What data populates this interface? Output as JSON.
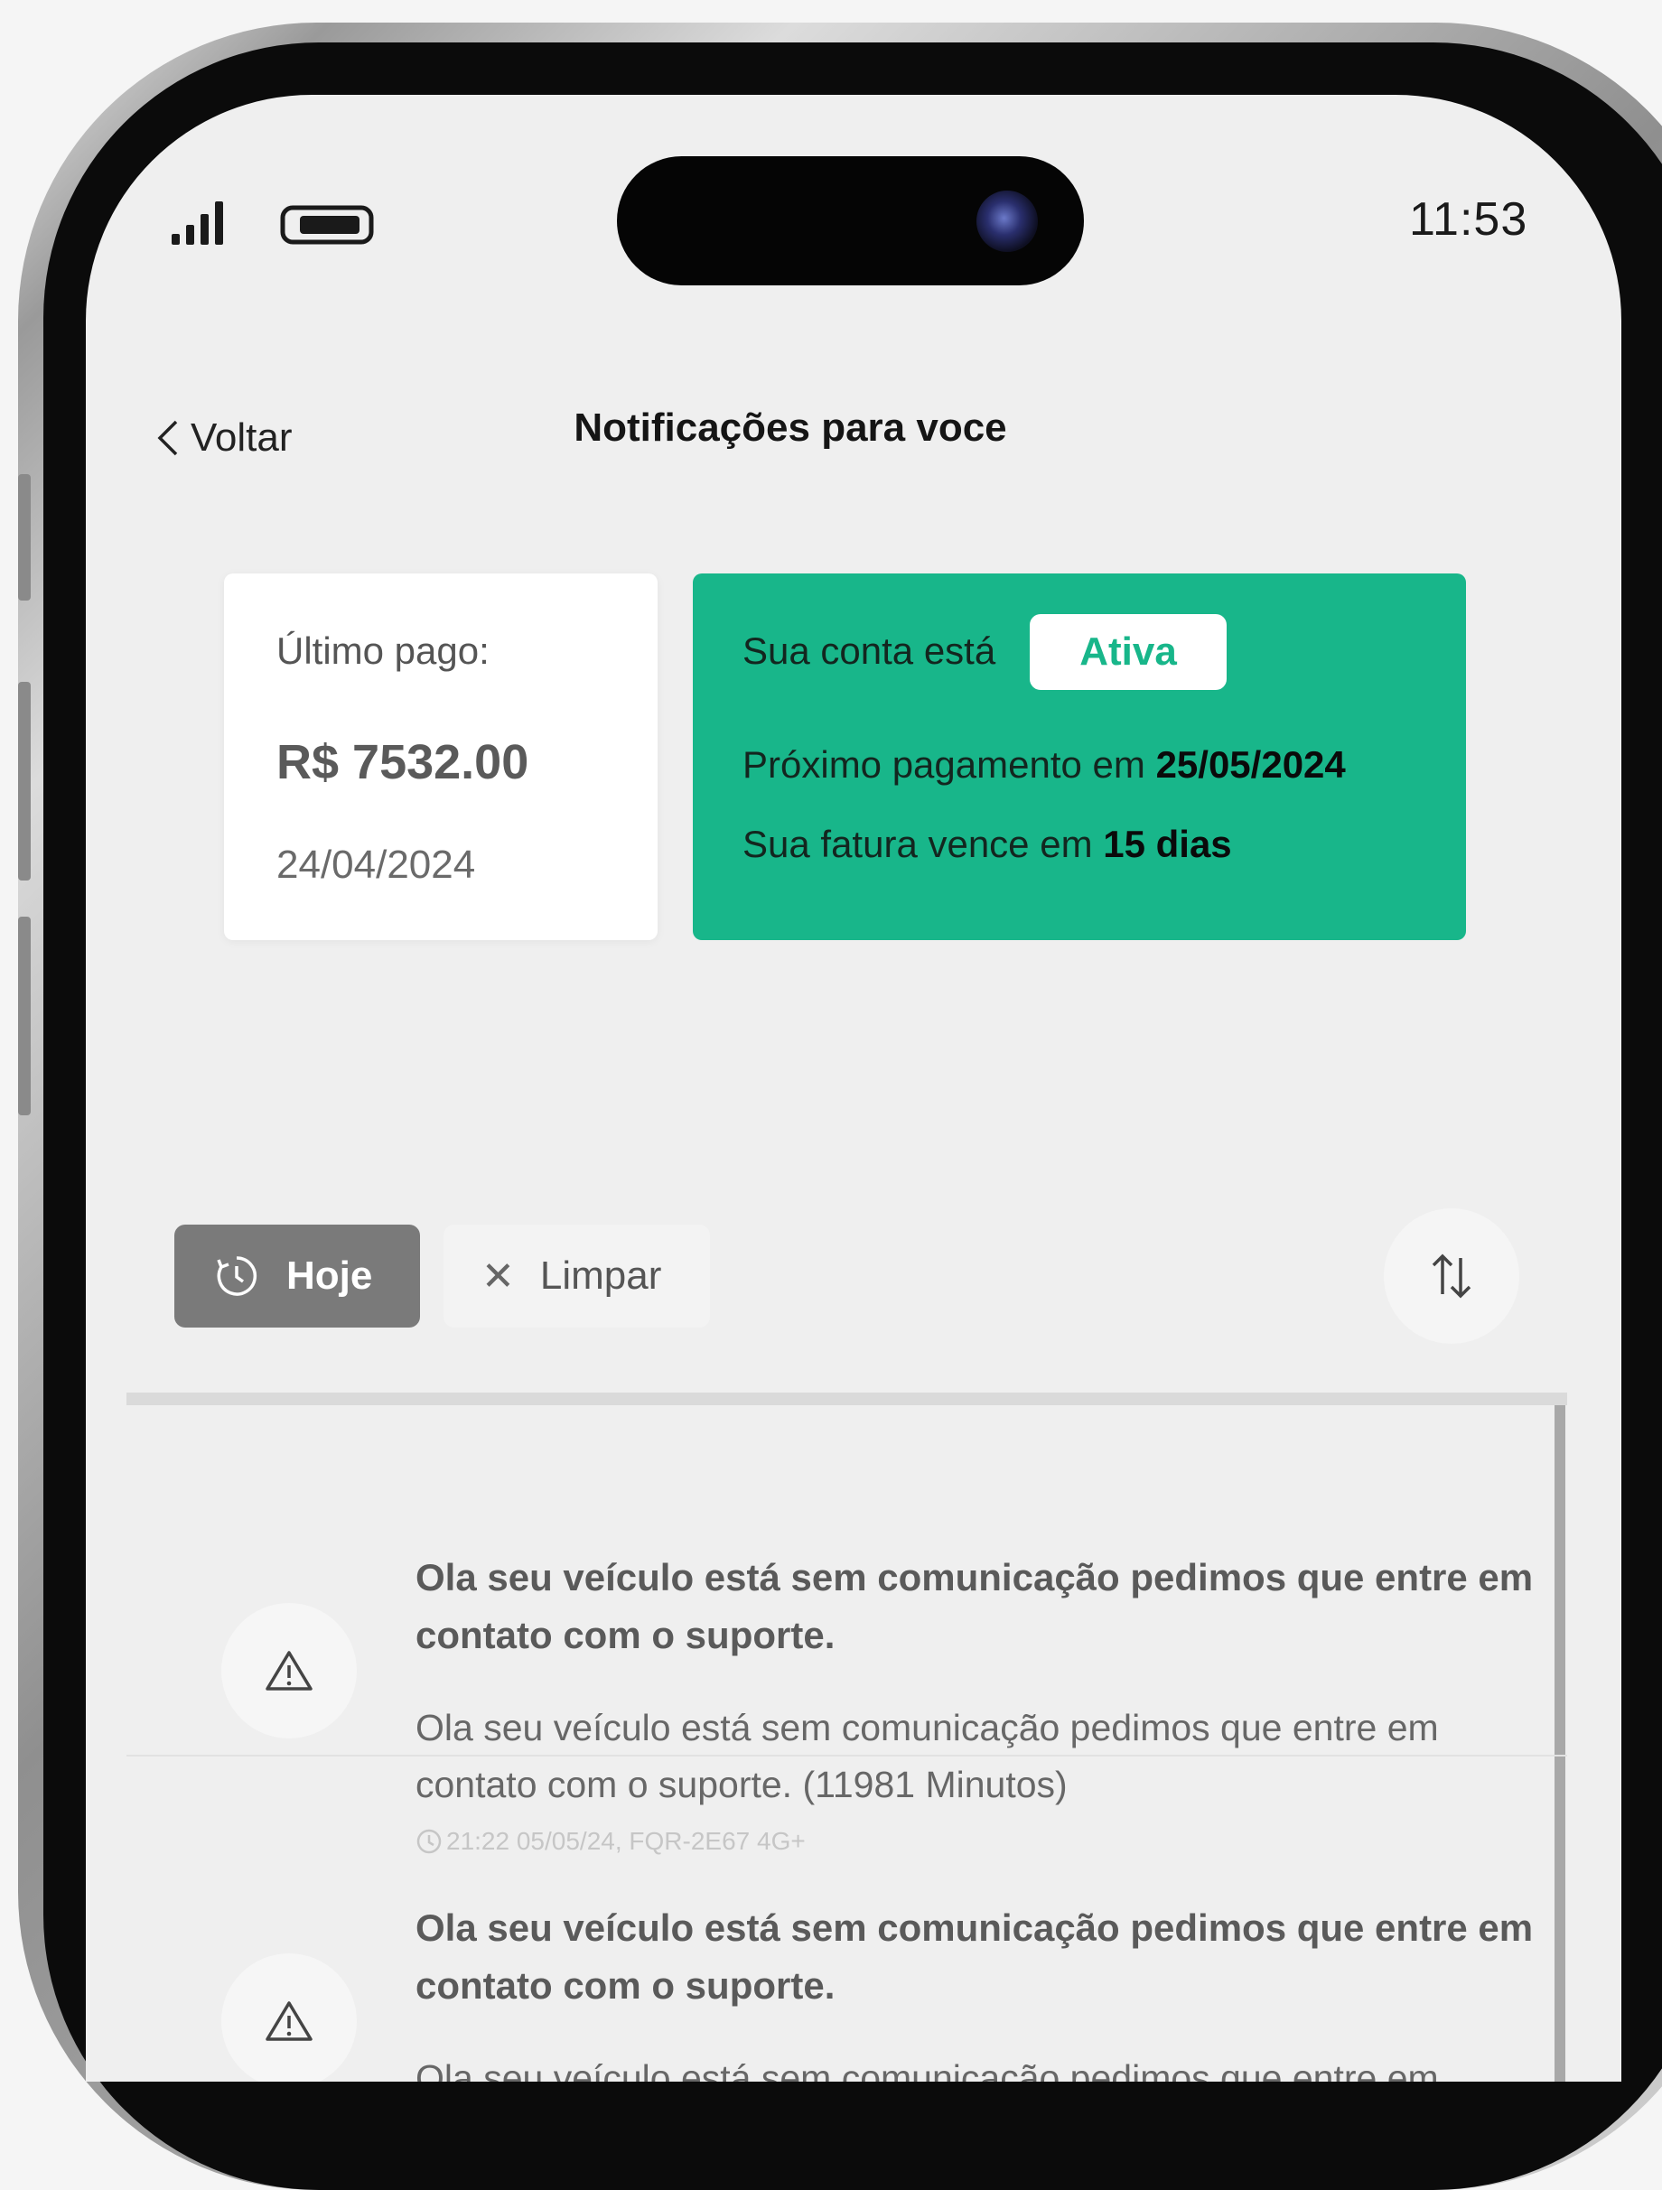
{
  "status_bar": {
    "time": "11:53"
  },
  "header": {
    "back_label": "Voltar",
    "title": "Notificações para voce"
  },
  "summary": {
    "last_paid_label": "Último pago:",
    "last_paid_amount": "R$ 7532.00",
    "last_paid_date": "24/04/2024",
    "account_status_prefix": "Sua conta está",
    "account_status": "Ativa",
    "next_payment_prefix": "Próximo pagamento em ",
    "next_payment_date": "25/05/2024",
    "invoice_due_prefix": "Sua fatura vence em ",
    "invoice_due_value": "15 dias",
    "accent_color": "#18b68a"
  },
  "filters": {
    "today_label": "Hoje",
    "today_icon": "clock-icon",
    "clear_label": "Limpar",
    "clear_icon": "close-icon",
    "sort_icon": "sort-icon"
  },
  "notifications": [
    {
      "icon": "warning-icon",
      "title": "Ola seu veículo está sem comunicação pedimos que entre em contato com o suporte.",
      "body": "Ola seu veículo está sem comunicação pedimos que entre em contato com o suporte. (11981 Minutos)",
      "meta": "21:22 05/05/24, FQR-2E67 4G+"
    },
    {
      "icon": "warning-icon",
      "title": "Ola seu veículo está sem comunicação pedimos que entre em contato com o suporte.",
      "body": "Ola seu veículo está sem comunicação pedimos que entre em"
    }
  ]
}
